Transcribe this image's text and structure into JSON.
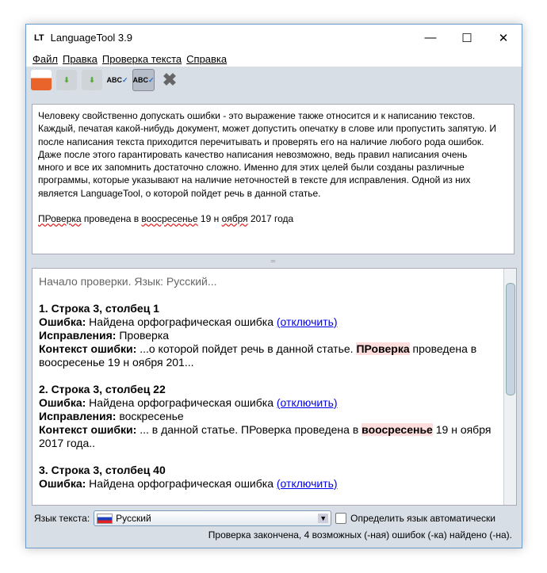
{
  "window": {
    "logo": "LT",
    "title": "LanguageTool 3.9"
  },
  "menu": [
    "Файл",
    "Правка",
    "Проверка текста",
    "Справка"
  ],
  "editor": {
    "lines": [
      "Человеку свойственно допускать ошибки - это выражение также относится и к написанию текстов.",
      "Каждый, печатая какой-нибудь документ, может допустить опечатку в слове или пропустить запятую. И",
      "после написания текста приходится перечитывать и проверять его на наличие любого рода ошибок.",
      "Даже после этого гарантировать качество написания невозможно, ведь правил написания очень",
      "много и все их запомнить достаточно сложно. Именно для этих целей были созданы различные",
      "программы, которые указывают на наличие неточностей в тексте для исправления. Одной из них",
      "является LanguageTool, о которой пойдет речь в данной статье."
    ],
    "last": {
      "w1": "ПРоверка",
      "t1": " проведена в ",
      "w2": "воосресенье",
      "t2": " 19 н ",
      "w3": "оября",
      "t3": " 2017 года"
    }
  },
  "results": {
    "start": "Начало проверки. Язык: Русский...",
    "labels": {
      "error": "Ошибка:",
      "fix": "Исправления:",
      "ctx": "Контекст ошибки:",
      "disable": "(отключить)"
    },
    "items": [
      {
        "head": "1. Строка 3, столбец 1",
        "error": " Найдена орфографическая ошибка ",
        "fix": " Проверка",
        "pre": " ...о которой пойдет речь в данной статье. ",
        "hl": "ПРоверка",
        "post": " проведена в воосресенье 19 н оября 201..."
      },
      {
        "head": "2. Строка 3, столбец 22",
        "error": " Найдена орфографическая ошибка ",
        "fix": " воскресенье",
        "pre": " ... в данной статье. ПРоверка проведена в ",
        "hl": "воосресенье",
        "post": " 19 н оября 2017 года.."
      },
      {
        "head": "3. Строка 3, столбец 40",
        "error": " Найдена орфографическая ошибка "
      }
    ]
  },
  "bottom": {
    "lang_label": "Язык текста:",
    "lang": "Русский",
    "auto": "Определить язык автоматически",
    "status": "Проверка закончена, 4 возможных (-ная)  ошибок (-ка) найдено (-на)."
  }
}
